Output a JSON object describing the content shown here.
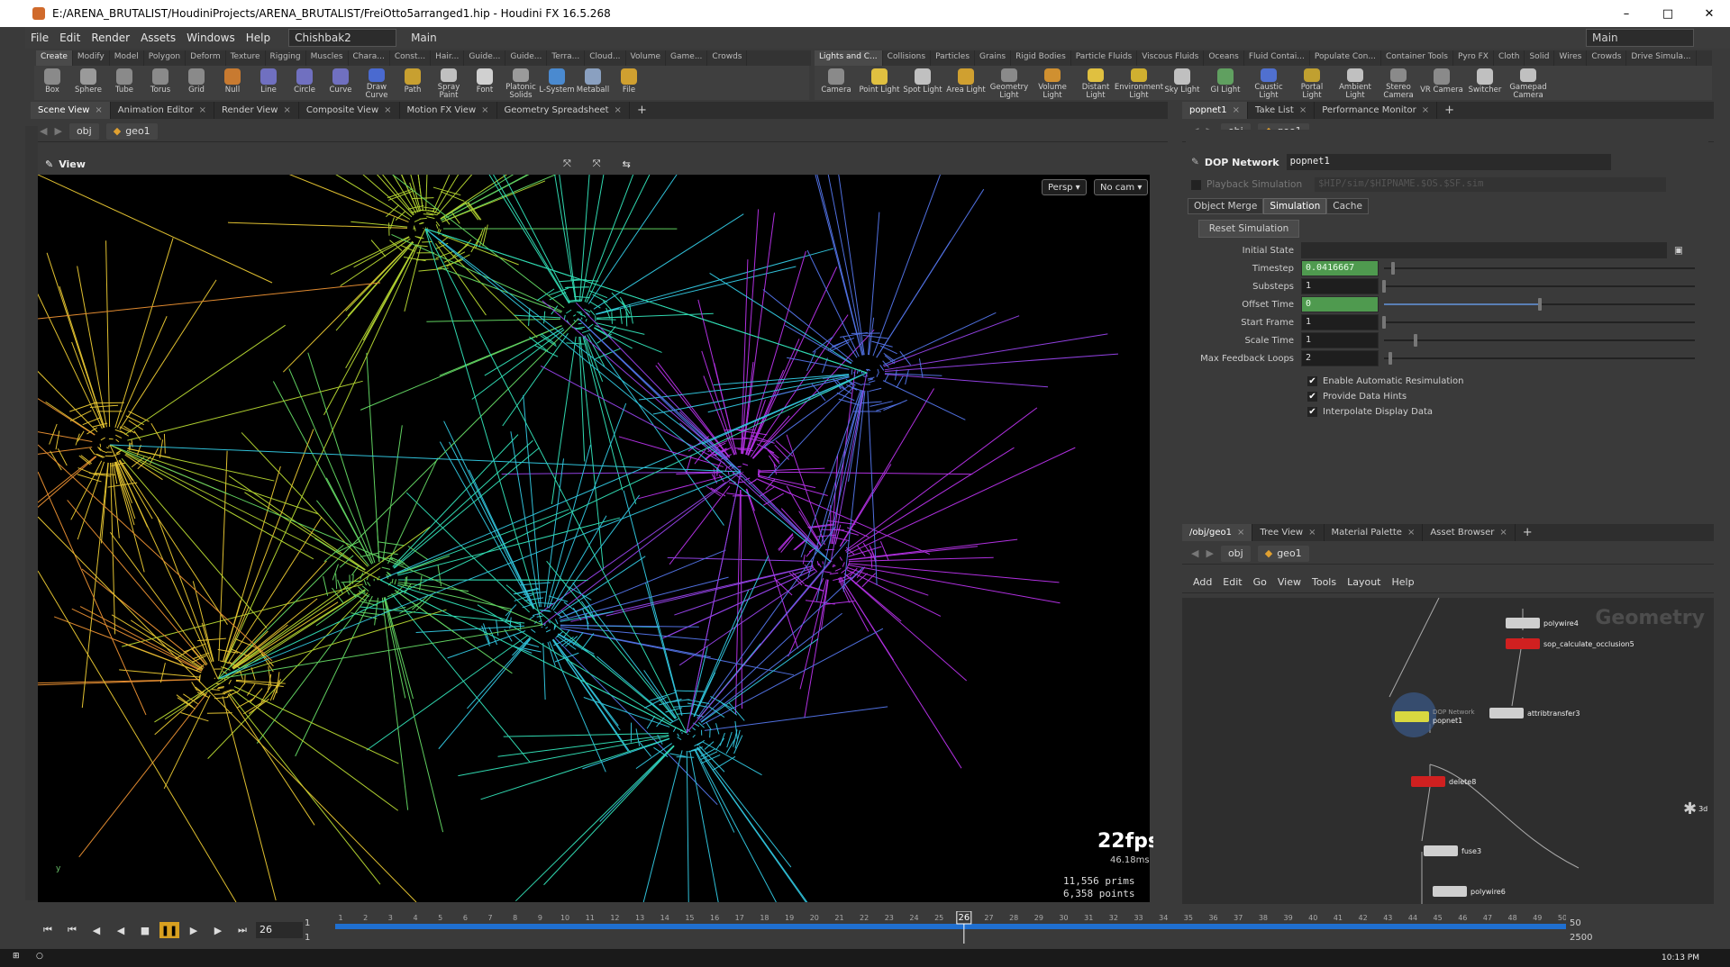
{
  "window": {
    "title": "E:/ARENA_BRUTALIST/HoudiniProjects/ARENA_BRUTALIST/FreiOtto5arranged1.hip - Houdini FX 16.5.268",
    "controls": [
      "–",
      "□",
      "✕"
    ]
  },
  "menu": {
    "items": [
      "File",
      "Edit",
      "Render",
      "Assets",
      "Windows",
      "Help"
    ],
    "desktop": "Chishbak2",
    "desktop2": "Main",
    "right_desktop": "Main"
  },
  "shelf_left_tabs": [
    "Create",
    "Modify",
    "Model",
    "Polygon",
    "Deform",
    "Texture",
    "Rigging",
    "Muscles",
    "Chara...",
    "Const...",
    "Hair...",
    "Guide...",
    "Guide...",
    "Terra...",
    "Cloud...",
    "Volume",
    "Game...",
    "Crowds"
  ],
  "shelf_right_tabs": [
    "Lights and C...",
    "Collisions",
    "Particles",
    "Grains",
    "Rigid Bodies",
    "Particle Fluids",
    "Viscous Fluids",
    "Oceans",
    "Fluid Contai...",
    "Populate Con...",
    "Container Tools",
    "Pyro FX",
    "Cloth",
    "Solid",
    "Wires",
    "Crowds",
    "Drive Simula..."
  ],
  "tools_left": [
    {
      "label": "Box",
      "color": "#8a8a8a"
    },
    {
      "label": "Sphere",
      "color": "#9a9a9a"
    },
    {
      "label": "Tube",
      "color": "#8a8a8a"
    },
    {
      "label": "Torus",
      "color": "#8a8a8a"
    },
    {
      "label": "Grid",
      "color": "#8a8a8a"
    },
    {
      "label": "Null",
      "color": "#c87a30"
    },
    {
      "label": "Line",
      "color": "#7070c0"
    },
    {
      "label": "Circle",
      "color": "#7070c0"
    },
    {
      "label": "Curve",
      "color": "#7070c0"
    },
    {
      "label": "Draw Curve",
      "color": "#4a6ad0"
    },
    {
      "label": "Path",
      "color": "#c8a030"
    },
    {
      "label": "Spray Paint",
      "color": "#c0c0c0"
    },
    {
      "label": "Font",
      "color": "#d0d0d0"
    },
    {
      "label": "Platonic Solids",
      "color": "#9a9a9a"
    },
    {
      "label": "L-System",
      "color": "#4a8ad0"
    },
    {
      "label": "Metaball",
      "color": "#8aa0c0"
    },
    {
      "label": "File",
      "color": "#d0a030"
    }
  ],
  "tools_right": [
    {
      "label": "Camera",
      "color": "#8a8a8a"
    },
    {
      "label": "Point Light",
      "color": "#e0c040"
    },
    {
      "label": "Spot Light",
      "color": "#c0c0c0"
    },
    {
      "label": "Area Light",
      "color": "#d0a030"
    },
    {
      "label": "Geometry Light",
      "color": "#8a8a8a"
    },
    {
      "label": "Volume Light",
      "color": "#d09030"
    },
    {
      "label": "Distant Light",
      "color": "#e0c040"
    },
    {
      "label": "Environment Light",
      "color": "#d0b030"
    },
    {
      "label": "Sky Light",
      "color": "#c0c0c0"
    },
    {
      "label": "GI Light",
      "color": "#60a060"
    },
    {
      "label": "Caustic Light",
      "color": "#5070d0"
    },
    {
      "label": "Portal Light",
      "color": "#c0a030"
    },
    {
      "label": "Ambient Light",
      "color": "#c0c0c0"
    },
    {
      "label": "Stereo Camera",
      "color": "#8a8a8a"
    },
    {
      "label": "VR Camera",
      "color": "#8a8a8a"
    },
    {
      "label": "Switcher",
      "color": "#c0c0c0"
    },
    {
      "label": "Gamepad Camera",
      "color": "#c0c0c0"
    }
  ],
  "left_tabs": [
    "Scene View",
    "Animation Editor",
    "Render View",
    "Composite View",
    "Motion FX View",
    "Geometry Spreadsheet"
  ],
  "right_tabs": [
    "popnet1",
    "Take List",
    "Performance Monitor"
  ],
  "path": {
    "root": "obj",
    "node": "geo1"
  },
  "viewport": {
    "title": "View",
    "persp": "Persp ▾",
    "cam": "No cam ▾",
    "fps": "22fps",
    "ms": "46.18ms",
    "prims_label": "11,556  prims",
    "points_label": "6,358 points",
    "axis": "y"
  },
  "params": {
    "type": "DOP Network",
    "name": "popnet1",
    "playback": "Playback Simulation",
    "sim_path": "$HIP/sim/$HIPNAME.$OS.$SF.sim",
    "subtabs": [
      "Object Merge",
      "Simulation",
      "Cache"
    ],
    "reset": "Reset Simulation",
    "initial_state_label": "Initial State",
    "rows": [
      {
        "label": "Timestep",
        "value": "0.0416667",
        "green": true,
        "knob": 0.03
      },
      {
        "label": "Substeps",
        "value": "1",
        "green": false,
        "knob": 0.0
      },
      {
        "label": "Offset Time",
        "value": "0",
        "green": true,
        "knob": 0.5
      },
      {
        "label": "Start Frame",
        "value": "1",
        "green": false,
        "knob": 0.0
      },
      {
        "label": "Scale Time",
        "value": "1",
        "green": false,
        "knob": 0.1
      },
      {
        "label": "Max Feedback Loops",
        "value": "2",
        "green": false,
        "knob": 0.02
      }
    ],
    "checks": [
      "Enable Automatic Resimulation",
      "Provide Data Hints",
      "Interpolate Display Data"
    ]
  },
  "net": {
    "tabs": [
      "/obj/geo1",
      "Tree View",
      "Material Palette",
      "Asset Browser"
    ],
    "menu": [
      "Add",
      "Edit",
      "Go",
      "View",
      "Tools",
      "Layout",
      "Help"
    ],
    "context": "Geometry",
    "nodes": [
      {
        "name": "polywire4",
        "color": "#cfcfcf"
      },
      {
        "name": "sop_calculate_occlusion5",
        "color": "#d02020"
      },
      {
        "name": "attribtransfer3",
        "color": "#cfcfcf"
      },
      {
        "name": "popnet1",
        "color": "#d8d840"
      },
      {
        "name": "delete8",
        "color": "#d02020"
      },
      {
        "name": "fuse3",
        "color": "#cfcfcf"
      },
      {
        "name": "polywire6",
        "color": "#cfcfcf"
      },
      {
        "name": "3d",
        "color": "#cfcfcf"
      }
    ],
    "popnet_sub": "DOP Network"
  },
  "timeline": {
    "frame": "26",
    "start": "1",
    "start2": "1",
    "end": "50",
    "end2": "2500",
    "ticks": [
      "1",
      "2",
      "3",
      "4",
      "5",
      "6",
      "7",
      "8",
      "9",
      "10",
      "11",
      "12",
      "13",
      "14",
      "15",
      "16",
      "17",
      "18",
      "19",
      "20",
      "21",
      "22",
      "23",
      "24",
      "25",
      "26",
      "27",
      "28",
      "29",
      "30",
      "31",
      "32",
      "33",
      "34",
      "35",
      "36",
      "37",
      "38",
      "39",
      "40",
      "41",
      "42",
      "43",
      "44",
      "45",
      "46",
      "47",
      "48",
      "49",
      "50"
    ]
  },
  "taskbar": {
    "time": "10:13 PM"
  }
}
